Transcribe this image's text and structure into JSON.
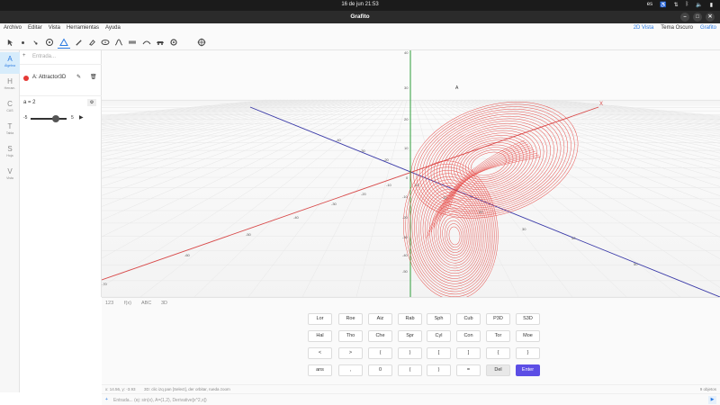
{
  "system": {
    "clock": "16 de jun  21:53",
    "lang": "es",
    "tray_icons": [
      "accessibility-icon",
      "network-icon",
      "bluetooth-icon",
      "volume-icon",
      "battery-icon"
    ]
  },
  "window": {
    "title": "Grafito",
    "controls": [
      "minimize",
      "maximize",
      "close"
    ]
  },
  "menus": [
    "Archivo",
    "Editar",
    "Vista",
    "Herramientas",
    "Ayuda"
  ],
  "view_switch": {
    "view2d": "2D Vista",
    "theme": "Tema Oscuro",
    "app": "Grafito"
  },
  "tools": [
    "pointer",
    "point",
    "slope-point",
    "circle-point",
    "triangle",
    "pen",
    "eraser",
    "ellipse",
    "ruler",
    "curve",
    "wave",
    "car",
    "settings",
    "target"
  ],
  "nav": [
    {
      "letter": "A",
      "label": "Álgebra"
    },
    {
      "letter": "H",
      "label": "Herram."
    },
    {
      "letter": "C",
      "label": "CAS"
    },
    {
      "letter": "T",
      "label": "Tabla"
    },
    {
      "letter": "S",
      "label": "Hoja"
    },
    {
      "letter": "V",
      "label": "Vista"
    }
  ],
  "algebra": {
    "input_placeholder": "Entrada...",
    "object_label": "A: Attractor3D",
    "slider_label": "a = 2",
    "slider_min": "-5",
    "slider_max": "5",
    "slider_value": 2,
    "slider_range": [
      -5,
      5
    ]
  },
  "canvas": {
    "point_label": "A",
    "x_axis_label": "X",
    "z_ticks": [
      "40",
      "30",
      "20",
      "10",
      "0",
      "-10",
      "-20",
      "-30",
      "-40",
      "-50"
    ],
    "x_ticks": [
      "-70",
      "-60",
      "-50",
      "-40",
      "-30",
      "-20",
      "-10"
    ],
    "y_ticks": [
      "-40",
      "-30",
      "-20",
      "-10",
      "10",
      "20",
      "30",
      "40",
      "50"
    ],
    "accent_colors": {
      "x_axis": "#d84a4a",
      "y_axis": "#3a3aa8",
      "z_axis": "#2e9d3a",
      "curve": "#e53935"
    }
  },
  "keyboard_tabs": [
    "123",
    "f(x)",
    "ABC",
    "3D"
  ],
  "keyboard_rows": [
    [
      "Lor",
      "Roe",
      "Aiz",
      "Rab",
      "Sph",
      "Cub",
      "P3D",
      "S3D"
    ],
    [
      "Hal",
      "Tho",
      "Che",
      "Spr",
      "Cyl",
      "Con",
      "Tor",
      "Moe"
    ],
    [
      "<",
      ">",
      "(",
      ")",
      "[",
      "]",
      "{",
      "}"
    ],
    [
      "ans",
      ",",
      "0",
      "(",
      ")",
      "=",
      "Del",
      "Enter"
    ]
  ],
  "status": {
    "coords": "x: 14.56, y: -3.93",
    "hint": "3D: clic izq pan [Select], der orbitar, rueda zoom",
    "objects": "9 objetos"
  },
  "bottom_input": {
    "placeholder": "Entrada...  (ej: sin(x), A=(1,2), Derivative[x^2,x])"
  }
}
